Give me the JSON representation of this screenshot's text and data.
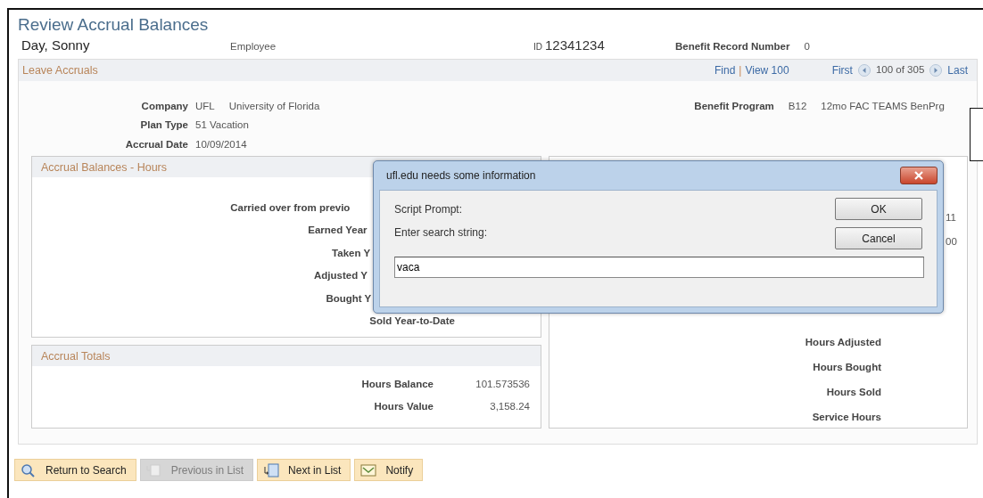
{
  "page": {
    "title": "Review Accrual Balances",
    "employee_name": "Day, Sonny",
    "employee_label": "Employee",
    "id_label": "ID",
    "id_value": "12341234",
    "record_label": "Benefit Record Number",
    "record_value": "0"
  },
  "leave_accruals": {
    "title": "Leave Accruals",
    "nav": {
      "find": "Find",
      "separator": "|",
      "view": "View 100",
      "first": "First",
      "count": "100 of 305",
      "last": "Last"
    },
    "fields": [
      {
        "label": "Company",
        "values": [
          "UFL",
          "University of Florida"
        ]
      },
      {
        "label": "Plan Type",
        "values": [
          "51 Vacation"
        ]
      },
      {
        "label": "Accrual Date",
        "values": [
          "10/09/2014"
        ]
      }
    ],
    "program": {
      "label": "Benefit Program",
      "values": [
        "B12",
        "12mo FAC TEAMS BenPrg"
      ]
    }
  },
  "balances": {
    "title": "Accrual Balances - Hours",
    "rows": [
      {
        "label": "Carried over from previo",
        "kind": "cut"
      },
      {
        "label": "Earned Year",
        "kind": "cut"
      },
      {
        "label": "Taken Y",
        "kind": "cut"
      },
      {
        "label": "Adjusted Y",
        "kind": "cut"
      },
      {
        "label": "Bought Y",
        "kind": "cut"
      },
      {
        "label": "Sold Year-to-Date",
        "kind": "full"
      }
    ]
  },
  "right_panel": {
    "partial_values": [
      "11",
      "00"
    ],
    "rows": [
      "Hours Adjusted",
      "Hours Bought",
      "Hours Sold",
      "Service Hours"
    ]
  },
  "totals": {
    "title": "Accrual Totals",
    "rows": [
      {
        "label": "Hours Balance",
        "value": "101.573536"
      },
      {
        "label": "Hours Value",
        "value": "3,158.24"
      }
    ]
  },
  "buttons": [
    {
      "label": "Return to Search",
      "kind": "search",
      "disabled": false
    },
    {
      "label": "Previous in List",
      "kind": "prev",
      "disabled": true
    },
    {
      "label": "Next in List",
      "kind": "next",
      "disabled": false
    },
    {
      "label": "Notify",
      "kind": "notify",
      "disabled": false
    }
  ],
  "dialog": {
    "title": "ufl.edu needs some information",
    "prompt": "Script Prompt:",
    "message": "Enter search string:",
    "value": "vaca",
    "ok": "OK",
    "cancel": "Cancel"
  }
}
